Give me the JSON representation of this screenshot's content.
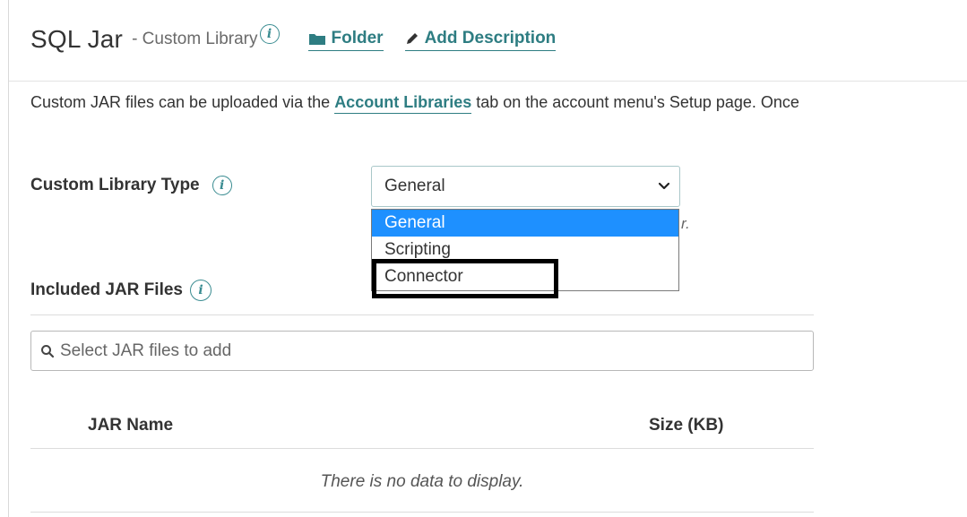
{
  "header": {
    "title": "SQL Jar",
    "subtitle": "- Custom Library",
    "folder_label": "Folder",
    "add_description_label": "Add Description"
  },
  "description": {
    "text_before": "Custom JAR files can be uploaded via the ",
    "link_label": "Account Libraries",
    "text_after": " tab on the account menu's Setup page. Once"
  },
  "library_type": {
    "label": "Custom Library Type",
    "selected_value": "General",
    "hint_fragment": "r.",
    "options": [
      "General",
      "Scripting",
      "Connector"
    ],
    "highlighted_option": "General"
  },
  "jar_files": {
    "section_label": "Included JAR Files",
    "search_placeholder": "Select JAR files to add",
    "columns": {
      "name": "JAR Name",
      "size": "Size (KB)"
    },
    "empty_message": "There is no data to display."
  },
  "colors": {
    "accent": "#2e7d82",
    "selection": "#1e90ff",
    "highlight_border": "#000000"
  },
  "icons": {
    "info": "info-icon",
    "folder": "folder-icon",
    "pencil": "pencil-icon",
    "chevron": "chevron-down-icon",
    "search": "search-icon"
  }
}
